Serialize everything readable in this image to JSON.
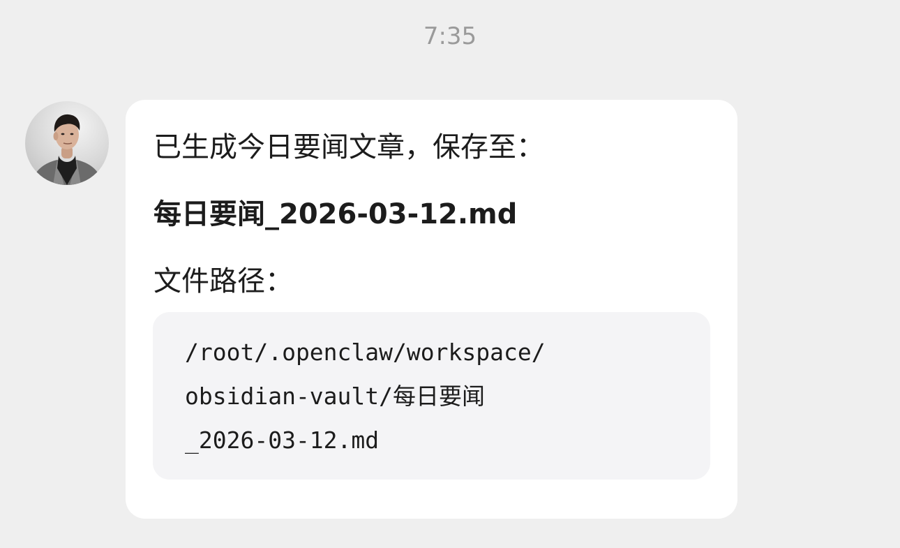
{
  "conversation": {
    "timestamp": "7:35"
  },
  "message": {
    "sender_avatar_icon": "person-avatar-icon",
    "intro_text": "已生成今日要闻文章，保存至：",
    "file_name": "每日要闻_2026-03-12.md",
    "path_label": "文件路径：",
    "file_path_lines": [
      "/root/.openclaw/workspace/",
      "obsidian-vault/每日要闻",
      "_2026-03-12.md"
    ]
  },
  "colors": {
    "background": "#efefef",
    "bubble": "#ffffff",
    "code_block": "#f4f4f6",
    "text": "#1c1c1c",
    "timestamp": "#9a9a9a"
  }
}
